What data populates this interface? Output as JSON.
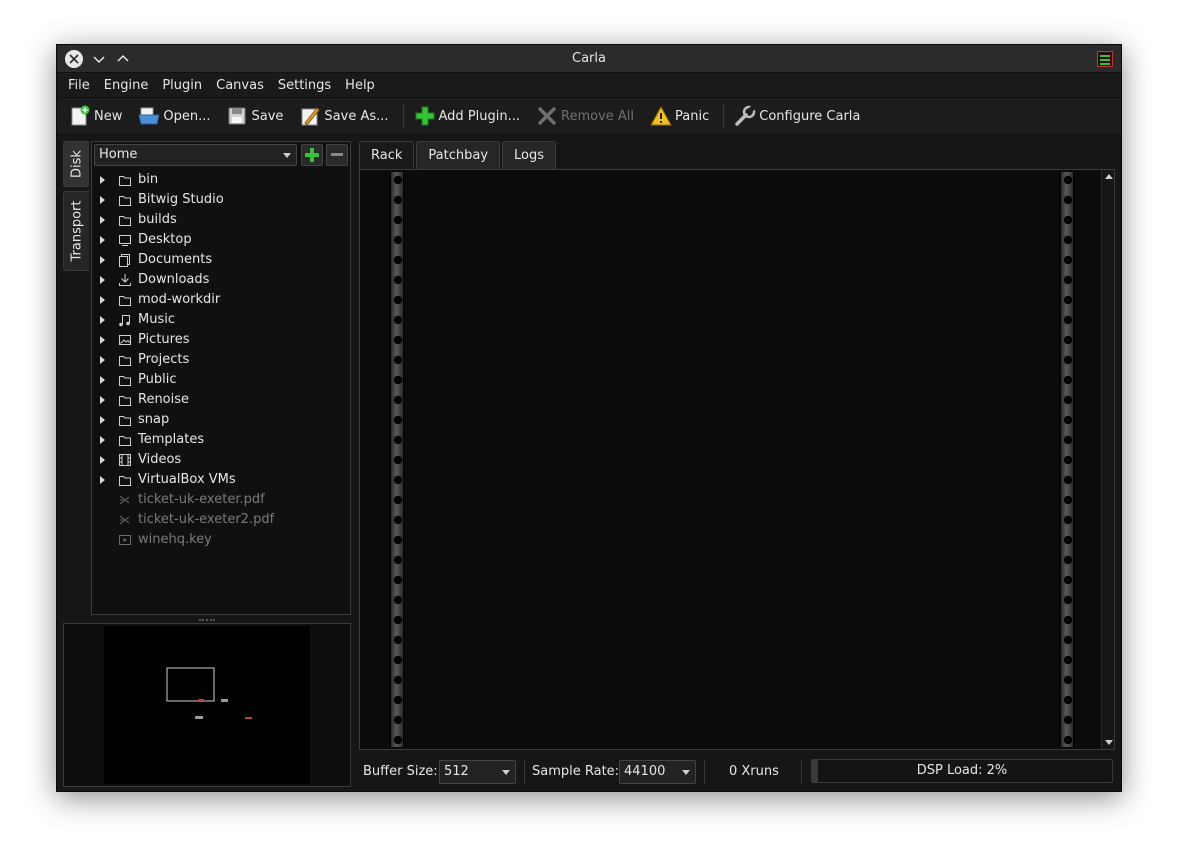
{
  "window": {
    "title": "Carla"
  },
  "menu": [
    "File",
    "Engine",
    "Plugin",
    "Canvas",
    "Settings",
    "Help"
  ],
  "toolbar": {
    "new": "New",
    "open": "Open...",
    "save": "Save",
    "save_as": "Save As...",
    "add_plugin": "Add Plugin...",
    "remove_all": "Remove All",
    "panic": "Panic",
    "configure": "Configure Carla"
  },
  "side_tabs": {
    "disk": "Disk",
    "transport": "Transport"
  },
  "disk": {
    "location": "Home",
    "entries": [
      {
        "name": "bin",
        "icon": "folder-icon",
        "expandable": true
      },
      {
        "name": "Bitwig Studio",
        "icon": "folder-icon",
        "expandable": true
      },
      {
        "name": "builds",
        "icon": "folder-icon",
        "expandable": true
      },
      {
        "name": "Desktop",
        "icon": "desktop-icon",
        "expandable": true
      },
      {
        "name": "Documents",
        "icon": "documents-icon",
        "expandable": true
      },
      {
        "name": "Downloads",
        "icon": "download-icon",
        "expandable": true
      },
      {
        "name": "mod-workdir",
        "icon": "folder-icon",
        "expandable": true
      },
      {
        "name": "Music",
        "icon": "music-icon",
        "expandable": true
      },
      {
        "name": "Pictures",
        "icon": "pictures-icon",
        "expandable": true
      },
      {
        "name": "Projects",
        "icon": "folder-icon",
        "expandable": true
      },
      {
        "name": "Public",
        "icon": "folder-icon",
        "expandable": true
      },
      {
        "name": "Renoise",
        "icon": "folder-icon",
        "expandable": true
      },
      {
        "name": "snap",
        "icon": "folder-icon",
        "expandable": true
      },
      {
        "name": "Templates",
        "icon": "folder-icon",
        "expandable": true
      },
      {
        "name": "Videos",
        "icon": "video-icon",
        "expandable": true
      },
      {
        "name": "VirtualBox VMs",
        "icon": "folder-icon",
        "expandable": true
      },
      {
        "name": "ticket-uk-exeter.pdf",
        "icon": "pdf-file-icon",
        "expandable": false
      },
      {
        "name": "ticket-uk-exeter2.pdf",
        "icon": "pdf-file-icon",
        "expandable": false
      },
      {
        "name": "winehq.key",
        "icon": "key-file-icon",
        "expandable": false
      }
    ]
  },
  "tabs": [
    "Rack",
    "Patchbay",
    "Logs"
  ],
  "active_tab": "Rack",
  "status": {
    "buffer_label": "Buffer Size:",
    "buffer_value": "512",
    "samplerate_label": "Sample Rate:",
    "samplerate_value": "44100",
    "xruns": "0 Xruns",
    "dsp_load": "DSP Load: 2%",
    "dsp_load_fraction": 0.02
  },
  "colors": {
    "background": "#161616",
    "panel": "#101010",
    "accent_green": "#35c435",
    "warning_yellow": "#f0c020"
  }
}
